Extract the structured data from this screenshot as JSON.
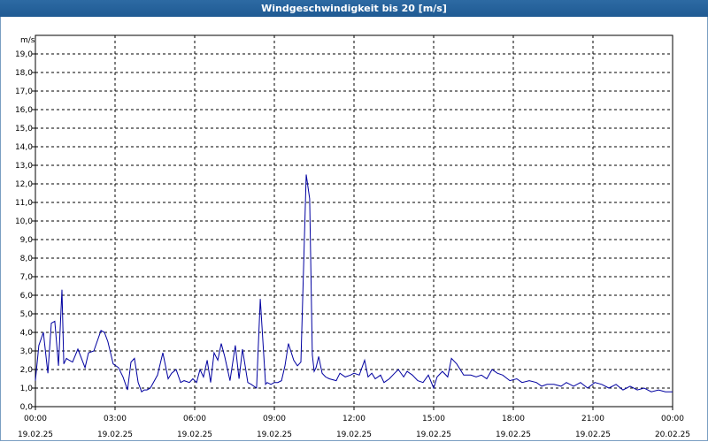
{
  "window": {
    "title": "Windgeschwindigkeit bis 20 [m/s]"
  },
  "chart_data": {
    "type": "line",
    "title": "Windgeschwindigkeit bis 20 [m/s]",
    "yunit": "m/s",
    "ylim": [
      0,
      20
    ],
    "xlim_hours": [
      0,
      24
    ],
    "grid": true,
    "y_ticks": [
      "0,0",
      "1,0",
      "2,0",
      "3,0",
      "4,0",
      "5,0",
      "6,0",
      "7,0",
      "8,0",
      "9,0",
      "10,0",
      "11,0",
      "12,0",
      "13,0",
      "14,0",
      "15,0",
      "16,0",
      "17,0",
      "18,0",
      "19,0"
    ],
    "x_ticks": [
      {
        "time": "00:00",
        "date": "19.02.25"
      },
      {
        "time": "03:00",
        "date": "19.02.25"
      },
      {
        "time": "06:00",
        "date": "19.02.25"
      },
      {
        "time": "09:00",
        "date": "19.02.25"
      },
      {
        "time": "12:00",
        "date": "19.02.25"
      },
      {
        "time": "15:00",
        "date": "19.02.25"
      },
      {
        "time": "18:00",
        "date": "19.02.25"
      },
      {
        "time": "21:00",
        "date": "19.02.25"
      },
      {
        "time": "00:00",
        "date": "20.02.25"
      }
    ],
    "series": [
      {
        "color": "#0000a0",
        "x_hours": [
          0.0,
          0.13,
          0.3,
          0.47,
          0.6,
          0.73,
          0.87,
          1.0,
          1.07,
          1.17,
          1.27,
          1.4,
          1.6,
          1.87,
          2.0,
          2.2,
          2.47,
          2.6,
          2.73,
          2.93,
          3.13,
          3.3,
          3.47,
          3.6,
          3.73,
          3.87,
          4.0,
          4.1,
          4.2,
          4.33,
          4.6,
          4.8,
          5.0,
          5.13,
          5.3,
          5.47,
          5.6,
          5.8,
          5.93,
          6.07,
          6.2,
          6.33,
          6.47,
          6.6,
          6.73,
          6.87,
          7.0,
          7.13,
          7.33,
          7.53,
          7.67,
          7.8,
          8.0,
          8.13,
          8.33,
          8.47,
          8.6,
          8.67,
          8.73,
          8.87,
          9.0,
          9.13,
          9.27,
          9.4,
          9.53,
          9.73,
          9.87,
          10.0,
          10.2,
          10.33,
          10.43,
          10.5,
          10.57,
          10.67,
          10.8,
          10.93,
          11.07,
          11.33,
          11.47,
          11.67,
          11.87,
          12.0,
          12.2,
          12.4,
          12.53,
          12.67,
          12.8,
          13.0,
          13.13,
          13.33,
          13.53,
          13.67,
          13.87,
          14.0,
          14.2,
          14.4,
          14.6,
          14.8,
          15.0,
          15.13,
          15.33,
          15.53,
          15.67,
          15.87,
          16.13,
          16.4,
          16.6,
          16.8,
          17.0,
          17.2,
          17.4,
          17.6,
          17.87,
          18.13,
          18.33,
          18.6,
          18.87,
          19.07,
          19.27,
          19.53,
          19.8,
          20.0,
          20.27,
          20.53,
          20.8,
          21.07,
          21.33,
          21.6,
          21.87,
          22.13,
          22.4,
          22.67,
          22.93,
          23.2,
          23.47,
          23.73,
          24.0
        ],
        "values": [
          1.4,
          3.3,
          4.0,
          1.8,
          4.5,
          4.6,
          2.2,
          6.3,
          2.3,
          2.6,
          2.5,
          2.4,
          3.1,
          2.1,
          2.9,
          3.0,
          4.1,
          4.0,
          3.5,
          2.3,
          2.1,
          1.6,
          0.9,
          2.4,
          2.6,
          1.3,
          0.8,
          0.9,
          0.9,
          1.0,
          1.7,
          2.9,
          1.5,
          1.8,
          2.0,
          1.3,
          1.4,
          1.3,
          1.5,
          1.3,
          2.0,
          1.6,
          2.5,
          1.3,
          2.9,
          2.5,
          3.4,
          2.7,
          1.4,
          3.3,
          1.5,
          3.1,
          1.3,
          1.2,
          1.0,
          5.8,
          2.8,
          1.2,
          1.3,
          1.2,
          1.3,
          1.3,
          1.4,
          2.2,
          3.4,
          2.5,
          2.2,
          2.4,
          12.5,
          11.2,
          2.8,
          1.9,
          2.1,
          2.7,
          1.8,
          1.6,
          1.5,
          1.4,
          1.8,
          1.6,
          1.7,
          1.8,
          1.7,
          2.5,
          1.6,
          1.8,
          1.5,
          1.7,
          1.3,
          1.5,
          1.8,
          2.0,
          1.6,
          1.9,
          1.7,
          1.4,
          1.3,
          1.7,
          1.0,
          1.6,
          1.9,
          1.6,
          2.6,
          2.3,
          1.7,
          1.7,
          1.6,
          1.7,
          1.5,
          2.0,
          1.8,
          1.7,
          1.4,
          1.5,
          1.3,
          1.4,
          1.3,
          1.1,
          1.2,
          1.2,
          1.1,
          1.3,
          1.1,
          1.3,
          1.0,
          1.3,
          1.2,
          1.0,
          1.2,
          0.9,
          1.1,
          0.9,
          1.0,
          0.8,
          0.9,
          0.8,
          0.8,
          0.7,
          1.0
        ]
      }
    ]
  }
}
